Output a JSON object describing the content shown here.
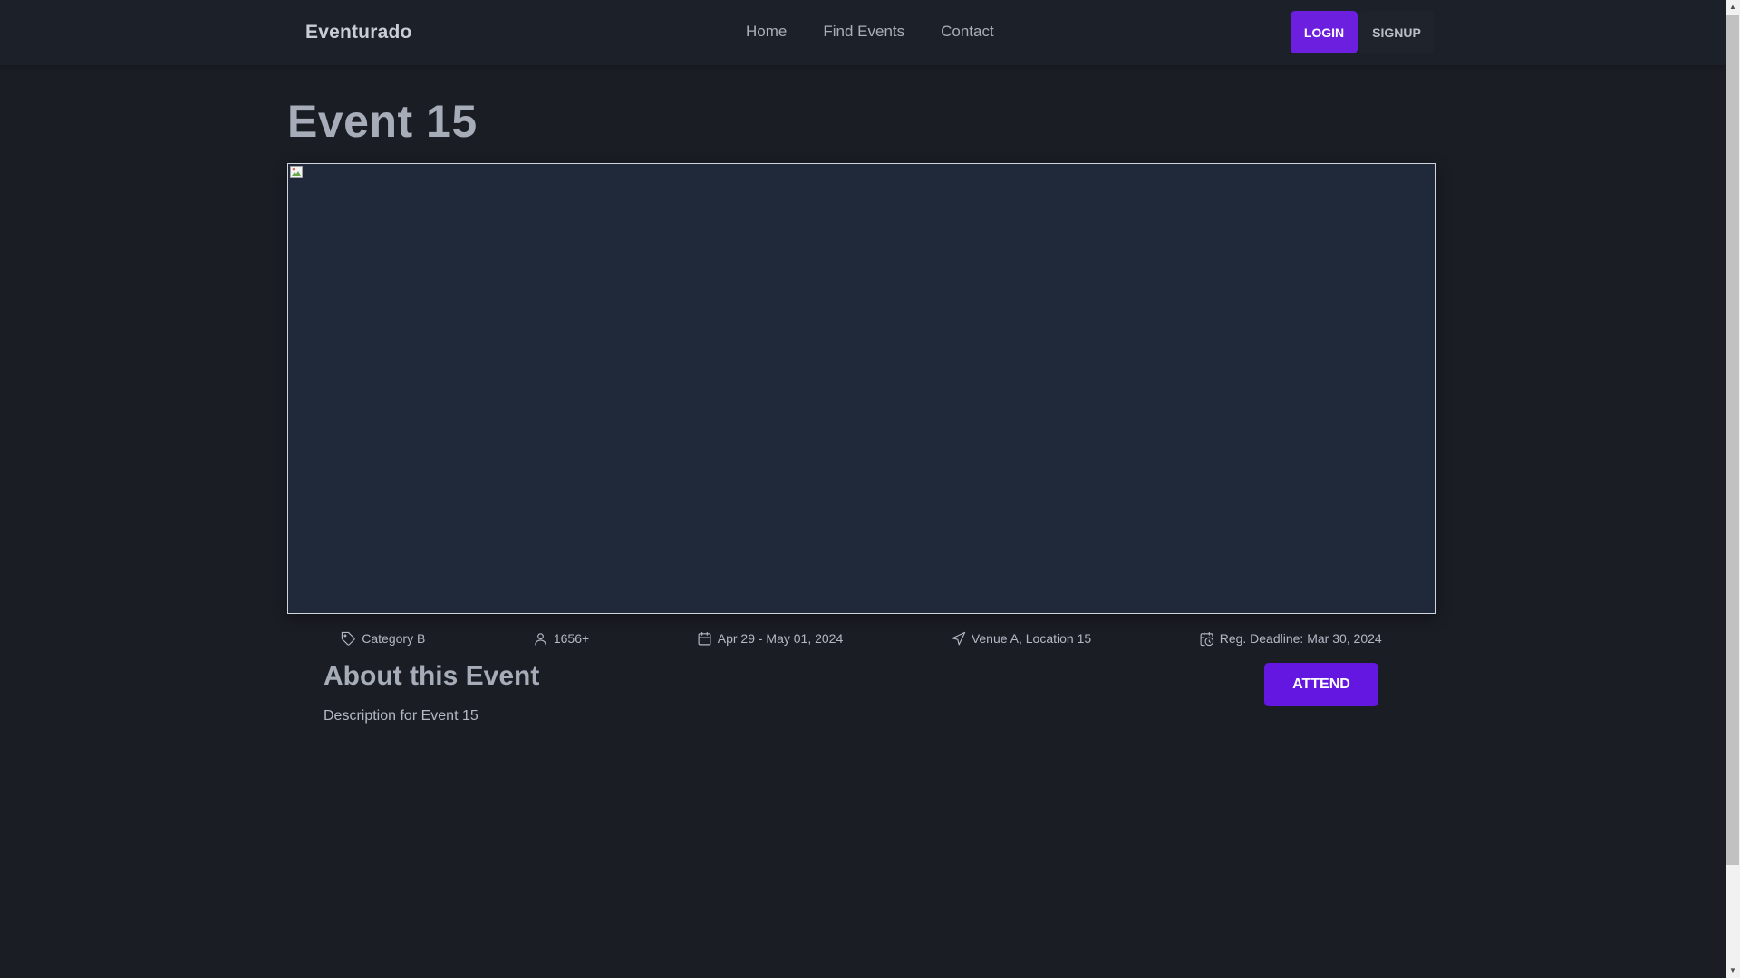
{
  "navbar": {
    "brand": "Eventurado",
    "links": [
      "Home",
      "Find Events",
      "Contact"
    ],
    "login_label": "LOGIN",
    "signup_label": "SIGNUP"
  },
  "event": {
    "title": "Event 15",
    "category": "Category B",
    "attendees": "1656+",
    "dates": "Apr 29 - May 01, 2024",
    "location": "Venue A, Location 15",
    "deadline": "Reg. Deadline: Mar 30, 2024"
  },
  "about": {
    "heading": "About this Event",
    "description": "Description for Event 15",
    "attend_label": "ATTEND"
  },
  "icons": {
    "category": "tag-icon",
    "attendees": "user-icon",
    "dates": "calendar-icon",
    "location": "navigation-arrow-icon",
    "deadline": "calendar-clock-icon"
  },
  "colors": {
    "accent": "#6d1fe0",
    "background": "#1a1d24",
    "navbar": "#1c2028",
    "hero_placeholder": "#1f2939"
  }
}
